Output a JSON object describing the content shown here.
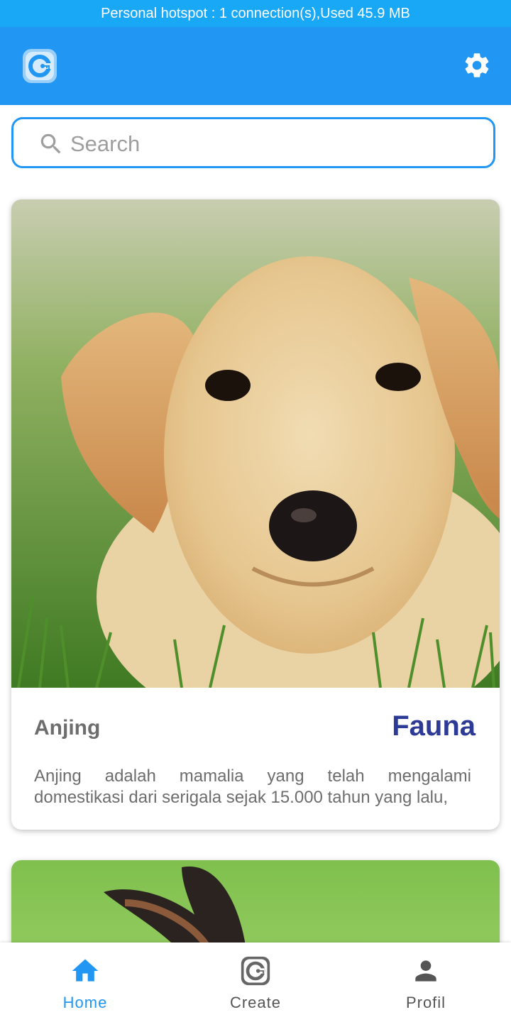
{
  "status_bar": {
    "text": "Personal hotspot : 1 connection(s),Used  45.9 MB"
  },
  "app_bar": {
    "logo_icon": "app-logo-icon",
    "settings_icon": "gear-icon",
    "color": "#2196f3"
  },
  "search": {
    "placeholder": "Search",
    "value": "",
    "icon": "search-icon"
  },
  "cards": [
    {
      "name": "Anjing",
      "category": "Fauna",
      "description": "Anjing adalah mamalia yang telah mengalami domestikasi dari serigala sejak 15.000 tahun yang lalu,",
      "image": "puppy-photo"
    },
    {
      "image": "rabbit-photo"
    }
  ],
  "bottom_nav": {
    "items": [
      {
        "label": "Home",
        "icon": "home-icon",
        "active": true
      },
      {
        "label": "Create",
        "icon": "create-icon",
        "active": false
      },
      {
        "label": "Profil",
        "icon": "person-icon",
        "active": false
      }
    ]
  },
  "colors": {
    "accent": "#2196f3",
    "category": "#2d3a96",
    "status_bar": "#19a8f5"
  }
}
